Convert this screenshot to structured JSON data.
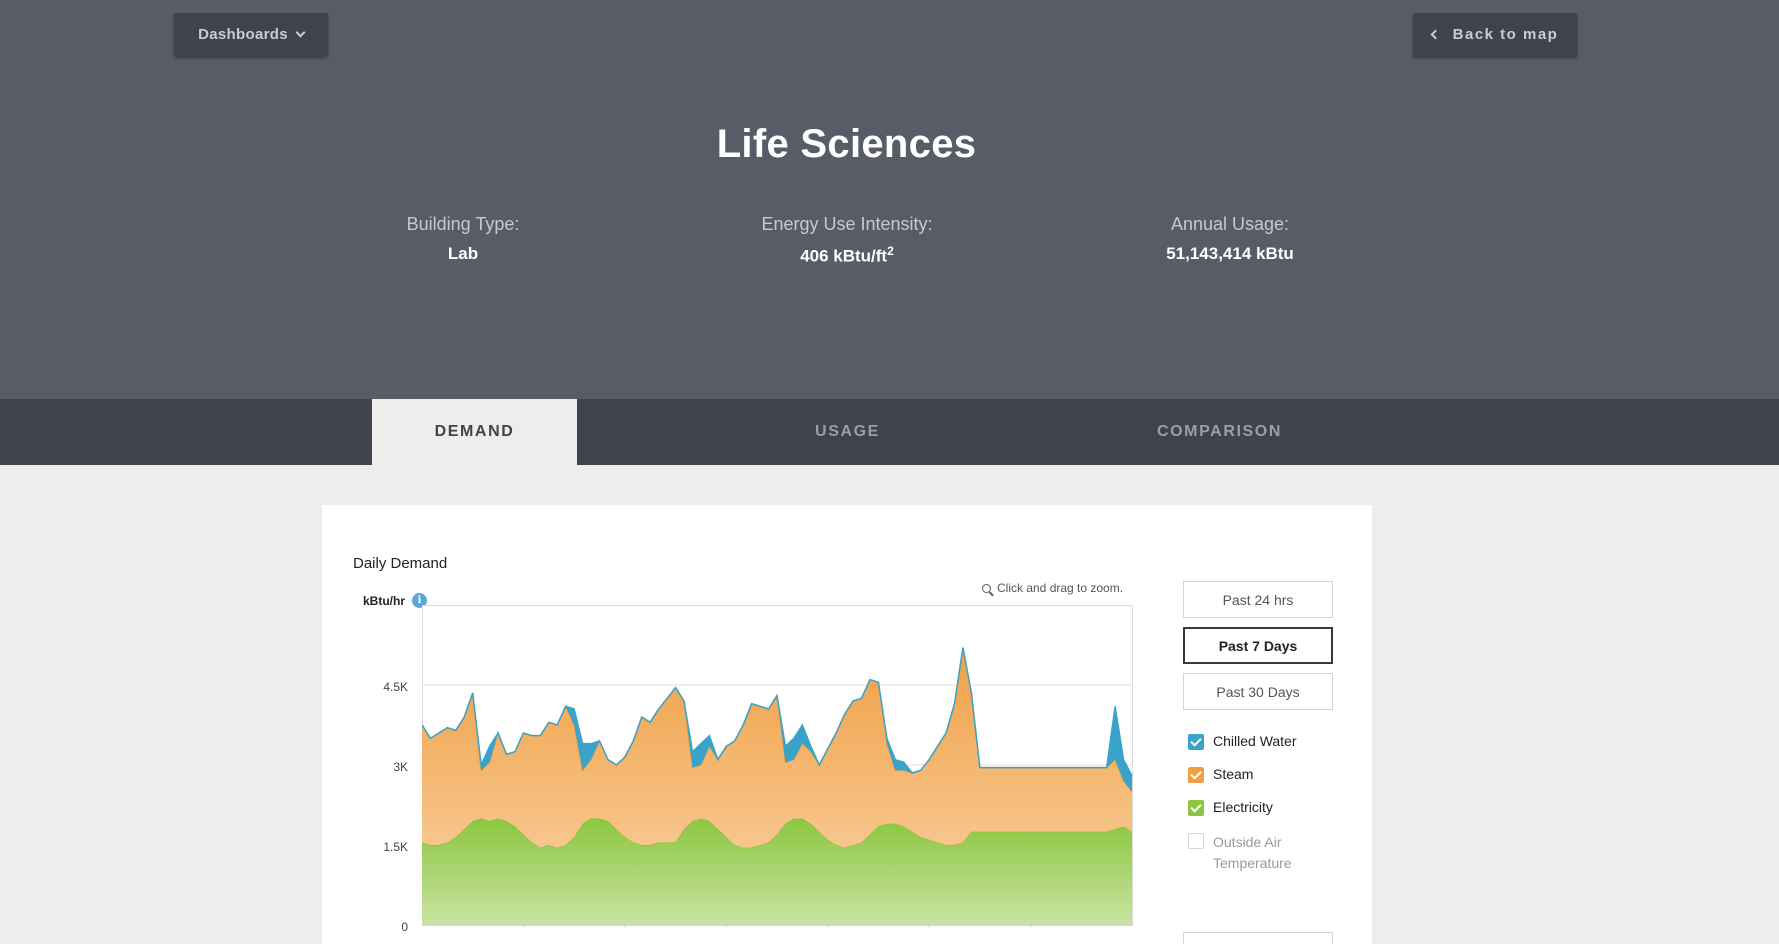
{
  "header": {
    "dashboards_label": "Dashboards",
    "back_label": "Back to map",
    "building_name": "Life Sciences",
    "stats": [
      {
        "label": "Building Type:",
        "value": "Lab"
      },
      {
        "label": "Energy Use Intensity:",
        "value": "406 kBtu/ft",
        "sup": "2"
      },
      {
        "label": "Annual Usage:",
        "value": "51,143,414 kBtu"
      }
    ]
  },
  "tabs": [
    {
      "label": "DEMAND",
      "active": true
    },
    {
      "label": "USAGE",
      "active": false
    },
    {
      "label": "COMPARISON",
      "active": false
    }
  ],
  "panel": {
    "title": "Daily Demand",
    "zoom_hint": "Click and drag to zoom.",
    "unit": "kBtu/hr",
    "info_icon": "info-icon",
    "range_buttons": [
      {
        "label": "Past 24 hrs",
        "active": false
      },
      {
        "label": "Past 7 Days",
        "active": true
      },
      {
        "label": "Past 30 Days",
        "active": false
      }
    ],
    "legend": [
      {
        "label": "Chilled Water",
        "checked": true,
        "color": "#3aa3c9"
      },
      {
        "label": "Steam",
        "checked": true,
        "color": "#f0a044"
      },
      {
        "label": "Electricity",
        "checked": true,
        "color": "#8cc63f"
      },
      {
        "label": "Outside Air  Temperature",
        "checked": false,
        "color": "#cccccc"
      }
    ]
  },
  "chart_data": {
    "type": "area",
    "stacked": true,
    "ylabel": "kBtu/hr",
    "yticks": [
      "0",
      "1.5K",
      "3K",
      "4.5K"
    ],
    "ylim": [
      0,
      6000
    ],
    "x": [
      0,
      2,
      4,
      6,
      8,
      10,
      12,
      14,
      16,
      18,
      20,
      22,
      24,
      26,
      28,
      30,
      32,
      34,
      36,
      38,
      40,
      42,
      44,
      46,
      48,
      50,
      52,
      54,
      56,
      58,
      60,
      62,
      64,
      66,
      68,
      70,
      72,
      74,
      76,
      78,
      80,
      82,
      84,
      86,
      88,
      90,
      92,
      94,
      96,
      98,
      100,
      102,
      104,
      106,
      108,
      110,
      112,
      114,
      116,
      118,
      120,
      122,
      124,
      126,
      128,
      130,
      132,
      134,
      136,
      138,
      140,
      142,
      144,
      146,
      148,
      150,
      152,
      154,
      156,
      158,
      160,
      162,
      164,
      166,
      168
    ],
    "series": [
      {
        "name": "Electricity",
        "color": "#8cc63f",
        "values": [
          1550,
          1500,
          1500,
          1550,
          1650,
          1800,
          1950,
          2000,
          1950,
          2000,
          1950,
          1850,
          1700,
          1550,
          1450,
          1500,
          1450,
          1500,
          1650,
          1900,
          2000,
          2000,
          1950,
          1800,
          1650,
          1550,
          1500,
          1500,
          1550,
          1550,
          1550,
          1800,
          1950,
          2000,
          1950,
          1800,
          1650,
          1500,
          1450,
          1450,
          1500,
          1550,
          1700,
          1900,
          2000,
          2000,
          1900,
          1750,
          1600,
          1500,
          1450,
          1500,
          1550,
          1700,
          1850,
          1900,
          1900,
          1850,
          1750,
          1650,
          1600,
          1550,
          1500,
          1500,
          1550,
          1750,
          1750,
          1750,
          1750,
          1750,
          1750,
          1750,
          1750,
          1750,
          1750,
          1750,
          1750,
          1750,
          1750,
          1750,
          1750,
          1750,
          1800,
          1850,
          1750
        ]
      },
      {
        "name": "Steam",
        "color": "#f0a044",
        "values": [
          2200,
          2000,
          2100,
          2150,
          2000,
          2100,
          2400,
          900,
          1100,
          1600,
          1250,
          1400,
          1900,
          2000,
          2100,
          2300,
          2300,
          2600,
          2100,
          1000,
          1100,
          1450,
          1150,
          1200,
          1500,
          1900,
          2400,
          2300,
          2500,
          2700,
          2900,
          2400,
          1000,
          1000,
          1400,
          1300,
          1700,
          1950,
          2300,
          2700,
          2600,
          2500,
          2600,
          1150,
          1100,
          1400,
          1350,
          1250,
          1700,
          2100,
          2500,
          2700,
          2700,
          2900,
          2700,
          1500,
          1000,
          1050,
          1100,
          1250,
          1500,
          1800,
          2100,
          2650,
          3650,
          2600,
          1200,
          1200,
          1200,
          1200,
          1200,
          1200,
          1200,
          1200,
          1200,
          1200,
          1200,
          1200,
          1200,
          1200,
          1200,
          1200,
          1300,
          850,
          750
        ]
      },
      {
        "name": "Chilled Water",
        "color": "#3aa3c9",
        "values": [
          0,
          0,
          0,
          0,
          0,
          0,
          0,
          100,
          300,
          0,
          0,
          0,
          0,
          0,
          0,
          0,
          0,
          0,
          300,
          500,
          300,
          0,
          0,
          0,
          0,
          0,
          0,
          0,
          0,
          0,
          0,
          0,
          300,
          400,
          200,
          0,
          0,
          0,
          0,
          0,
          0,
          0,
          0,
          300,
          400,
          350,
          100,
          0,
          0,
          0,
          0,
          0,
          0,
          0,
          0,
          100,
          200,
          150,
          0,
          0,
          0,
          0,
          0,
          0,
          0,
          0,
          0,
          0,
          0,
          0,
          0,
          0,
          0,
          0,
          0,
          0,
          0,
          0,
          0,
          0,
          0,
          0,
          1000,
          400,
          300
        ]
      }
    ]
  }
}
